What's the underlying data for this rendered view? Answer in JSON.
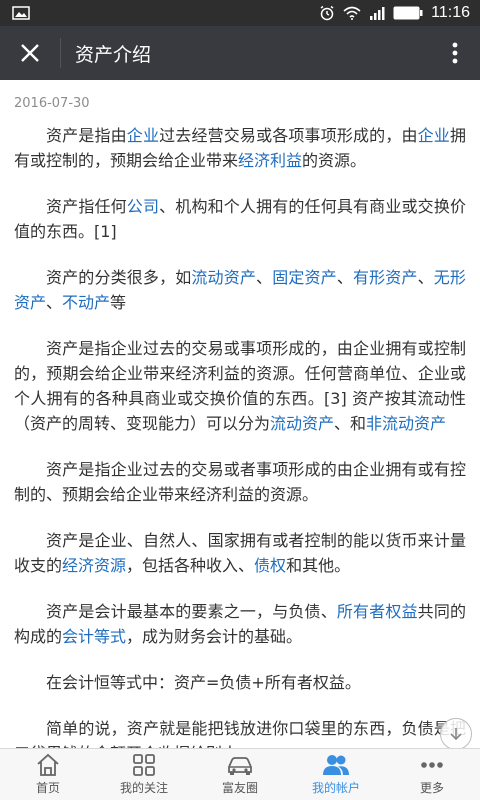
{
  "status_bar": {
    "battery": "100",
    "time": "11:16"
  },
  "header": {
    "title": "资产介绍"
  },
  "article": {
    "date": "2016-07-30",
    "paragraphs": [
      [
        {
          "t": "资产是指由"
        },
        {
          "t": "企业",
          "link": true
        },
        {
          "t": "过去经营交易或各项事项形成的，由"
        },
        {
          "t": "企业",
          "link": true
        },
        {
          "t": "拥有或控制的，预期会给企业带来"
        },
        {
          "t": "经济利益",
          "link": true
        },
        {
          "t": "的资源。"
        }
      ],
      [
        {
          "t": "资产指任何"
        },
        {
          "t": "公司",
          "link": true
        },
        {
          "t": "、机构和个人拥有的任何具有商业或交换价值的东西。[1]"
        }
      ],
      [
        {
          "t": "资产的分类很多，如"
        },
        {
          "t": "流动资产",
          "link": true
        },
        {
          "t": "、"
        },
        {
          "t": "固定资产",
          "link": true
        },
        {
          "t": "、"
        },
        {
          "t": "有形资产",
          "link": true
        },
        {
          "t": "、"
        },
        {
          "t": "无形资产",
          "link": true
        },
        {
          "t": "、"
        },
        {
          "t": "不动产",
          "link": true
        },
        {
          "t": "等"
        }
      ],
      [
        {
          "t": "资产是指企业过去的交易或事项形成的，由企业拥有或控制的，预期会给企业带来经济利益的资源。任何营商单位、企业或个人拥有的各种具商业或交换价值的东西。[3] 资产按其流动性（资产的周转、变现能力）可以分为"
        },
        {
          "t": "流动资产",
          "link": true
        },
        {
          "t": "、和"
        },
        {
          "t": "非流动资产",
          "link": true
        }
      ],
      [
        {
          "t": "资产是指企业过去的交易或者事项形成的由企业拥有或有控制的、预期会给企业带来经济利益的资源。"
        }
      ],
      [
        {
          "t": "资产是企业、自然人、国家拥有或者控制的能以货币来计量收支的"
        },
        {
          "t": "经济资源",
          "link": true
        },
        {
          "t": "，包括各种收入、"
        },
        {
          "t": "债权",
          "link": true
        },
        {
          "t": "和其他。"
        }
      ],
      [
        {
          "t": "资产是会计最基本的要素之一，与负债、"
        },
        {
          "t": "所有者权益",
          "link": true
        },
        {
          "t": "共同的构成的"
        },
        {
          "t": "会计等式",
          "link": true
        },
        {
          "t": "，成为财务会计的基础。"
        }
      ],
      [
        {
          "t": "在会计恒等式中：资产=负债+所有者权益。"
        }
      ],
      [
        {
          "t": "简单的说，资产就是能把钱放进你口袋里的东西，负债是把口袋里钱的金额开个收据给别人。"
        }
      ]
    ]
  },
  "tab_bar": {
    "items": [
      {
        "label": "首页",
        "icon": "home-icon"
      },
      {
        "label": "我的关注",
        "icon": "grid-icon"
      },
      {
        "label": "富友圈",
        "icon": "car-icon"
      },
      {
        "label": "我的帐户",
        "icon": "users-icon",
        "active": true
      },
      {
        "label": "更多",
        "icon": "more-dots-icon"
      }
    ]
  },
  "colors": {
    "link": "#1f6dbf",
    "title_bar": "#393a3f",
    "status_bar": "#2e2e2e",
    "tab_active": "#3b8fe0"
  }
}
